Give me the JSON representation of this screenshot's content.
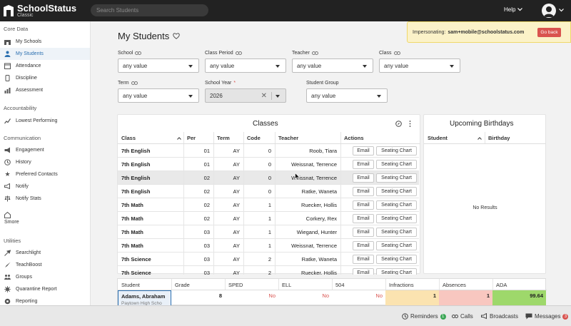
{
  "topbar": {
    "logo_name": "SchoolStatus",
    "logo_sub": "Classic",
    "search_placeholder": "Search Students",
    "help_label": "Help"
  },
  "sidebar": {
    "groups": {
      "core": "Core Data",
      "accountability": "Accountability",
      "communication": "Communication",
      "utilities": "Utilities"
    },
    "items": [
      {
        "label": "My Schools",
        "icon": "school-icon"
      },
      {
        "label": "My Students",
        "icon": "students-icon"
      },
      {
        "label": "Attendance",
        "icon": "attendance-icon"
      },
      {
        "label": "Discipline",
        "icon": "discipline-icon"
      },
      {
        "label": "Assessment",
        "icon": "assessment-icon"
      },
      {
        "label": "Lowest Performing",
        "icon": "trend-icon"
      },
      {
        "label": "Engagement",
        "icon": "engagement-icon"
      },
      {
        "label": "History",
        "icon": "history-icon"
      },
      {
        "label": "Preferred Contacts",
        "icon": "star-icon"
      },
      {
        "label": "Notify",
        "icon": "megaphone-icon"
      },
      {
        "label": "Notify Stats",
        "icon": "scale-icon"
      },
      {
        "label": "Smore",
        "icon": "smore-icon"
      },
      {
        "label": "Searchlight",
        "icon": "searchlight-icon"
      },
      {
        "label": "TeachBoost",
        "icon": "rocket-icon"
      },
      {
        "label": "Groups",
        "icon": "groups-icon"
      },
      {
        "label": "Quarantine Report",
        "icon": "virus-icon"
      },
      {
        "label": "Reporting",
        "icon": "reporting-icon"
      }
    ]
  },
  "page": {
    "title": "My Students"
  },
  "impersonation": {
    "label": "Impersonating:",
    "user": "sam+mobile@schoolstatus.com",
    "go_back": "Go back"
  },
  "filters": {
    "school": {
      "label": "School",
      "value": "any value"
    },
    "class_period": {
      "label": "Class Period",
      "value": "any value"
    },
    "teacher": {
      "label": "Teacher",
      "value": "any value"
    },
    "class": {
      "label": "Class",
      "value": "any value"
    },
    "term": {
      "label": "Term",
      "value": "any value"
    },
    "school_year": {
      "label": "School Year",
      "value": "2026",
      "required_mark": "*"
    },
    "student_group": {
      "label": "Student Group",
      "value": "any value"
    }
  },
  "classes": {
    "title": "Classes",
    "columns": [
      "Class",
      "Per",
      "Term",
      "Code",
      "Teacher",
      "Actions"
    ],
    "email_label": "Email",
    "seating_label": "Seating Chart",
    "rows": [
      {
        "class": "7th English",
        "per": "01",
        "term": "AY",
        "code": "0",
        "teacher": "Roob, Tiara"
      },
      {
        "class": "7th English",
        "per": "01",
        "term": "AY",
        "code": "0",
        "teacher": "Weissnat, Terrence"
      },
      {
        "class": "7th English",
        "per": "02",
        "term": "AY",
        "code": "0",
        "teacher": "Weissnat, Terrence"
      },
      {
        "class": "7th English",
        "per": "02",
        "term": "AY",
        "code": "0",
        "teacher": "Ratke, Waneta"
      },
      {
        "class": "7th Math",
        "per": "02",
        "term": "AY",
        "code": "1",
        "teacher": "Ruecker, Hollis"
      },
      {
        "class": "7th Math",
        "per": "02",
        "term": "AY",
        "code": "1",
        "teacher": "Corkery, Rex"
      },
      {
        "class": "7th Math",
        "per": "03",
        "term": "AY",
        "code": "1",
        "teacher": "Wiegand, Hunter"
      },
      {
        "class": "7th Math",
        "per": "03",
        "term": "AY",
        "code": "1",
        "teacher": "Weissnat, Terrence"
      },
      {
        "class": "7th Science",
        "per": "03",
        "term": "AY",
        "code": "2",
        "teacher": "Ratke, Waneta"
      },
      {
        "class": "7th Science",
        "per": "03",
        "term": "AY",
        "code": "2",
        "teacher": "Ruecker, Hollis"
      }
    ]
  },
  "birthdays": {
    "title": "Upcoming Birthdays",
    "columns": [
      "Student",
      "Birthday"
    ],
    "empty": "No Results"
  },
  "students": {
    "columns": [
      "Student",
      "Grade",
      "SPED",
      "ELL",
      "504",
      "Infractions",
      "Absences",
      "ADA"
    ],
    "rows": [
      {
        "name": "Adams, Abraham",
        "school": "Paytown High Scho",
        "grade": "8",
        "sped": "No",
        "ell": "No",
        "s504": "No",
        "infractions": "1",
        "absences": "1",
        "ada": "99.64"
      }
    ]
  },
  "bottombar": {
    "reminders": "Reminders",
    "reminders_count": "1",
    "calls": "Calls",
    "broadcasts": "Broadcasts",
    "messages": "Messages",
    "messages_count": "3"
  },
  "colors": {
    "accent": "#2a6fb0",
    "danger": "#d9534f",
    "warning_cell": "#fbe3b0",
    "absence_cell": "#f8c7c0",
    "ada_cell": "#9ed86b"
  }
}
